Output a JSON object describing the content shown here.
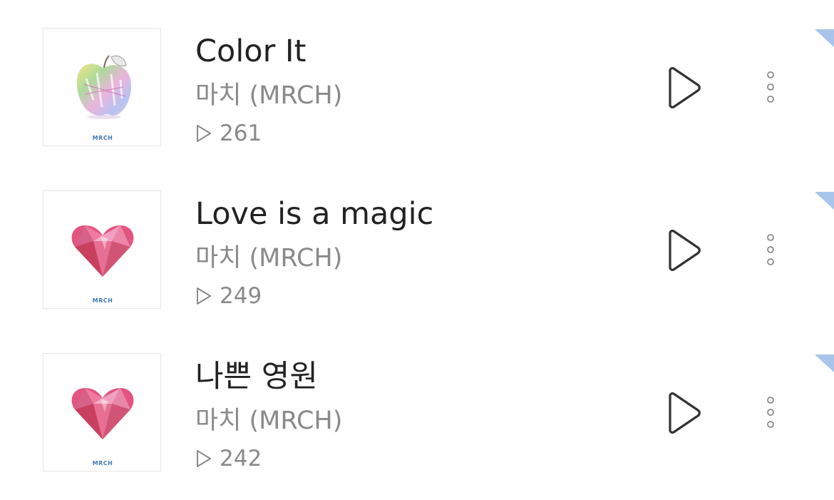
{
  "colors": {
    "title": "#222222",
    "secondary": "#8a8a8a",
    "icon_stroke": "#333333",
    "cover_border": "#e6e6e6",
    "corner_accent": "#a8c4ea"
  },
  "tracks": [
    {
      "title": "Color It",
      "artist": "마치 (MRCH)",
      "plays": "261",
      "cover_art": "rainbow-apple",
      "cover_logo": "MRCH",
      "play_icon": "play-icon",
      "more_icon": "more-vertical-icon"
    },
    {
      "title": "Love is a magic",
      "artist": "마치 (MRCH)",
      "plays": "249",
      "cover_art": "pink-gem-heart",
      "cover_logo": "MRCH",
      "play_icon": "play-icon",
      "more_icon": "more-vertical-icon"
    },
    {
      "title": "나쁜 영원",
      "artist": "마치 (MRCH)",
      "plays": "242",
      "cover_art": "pink-gem-heart",
      "cover_logo": "MRCH",
      "play_icon": "play-icon",
      "more_icon": "more-vertical-icon"
    }
  ]
}
